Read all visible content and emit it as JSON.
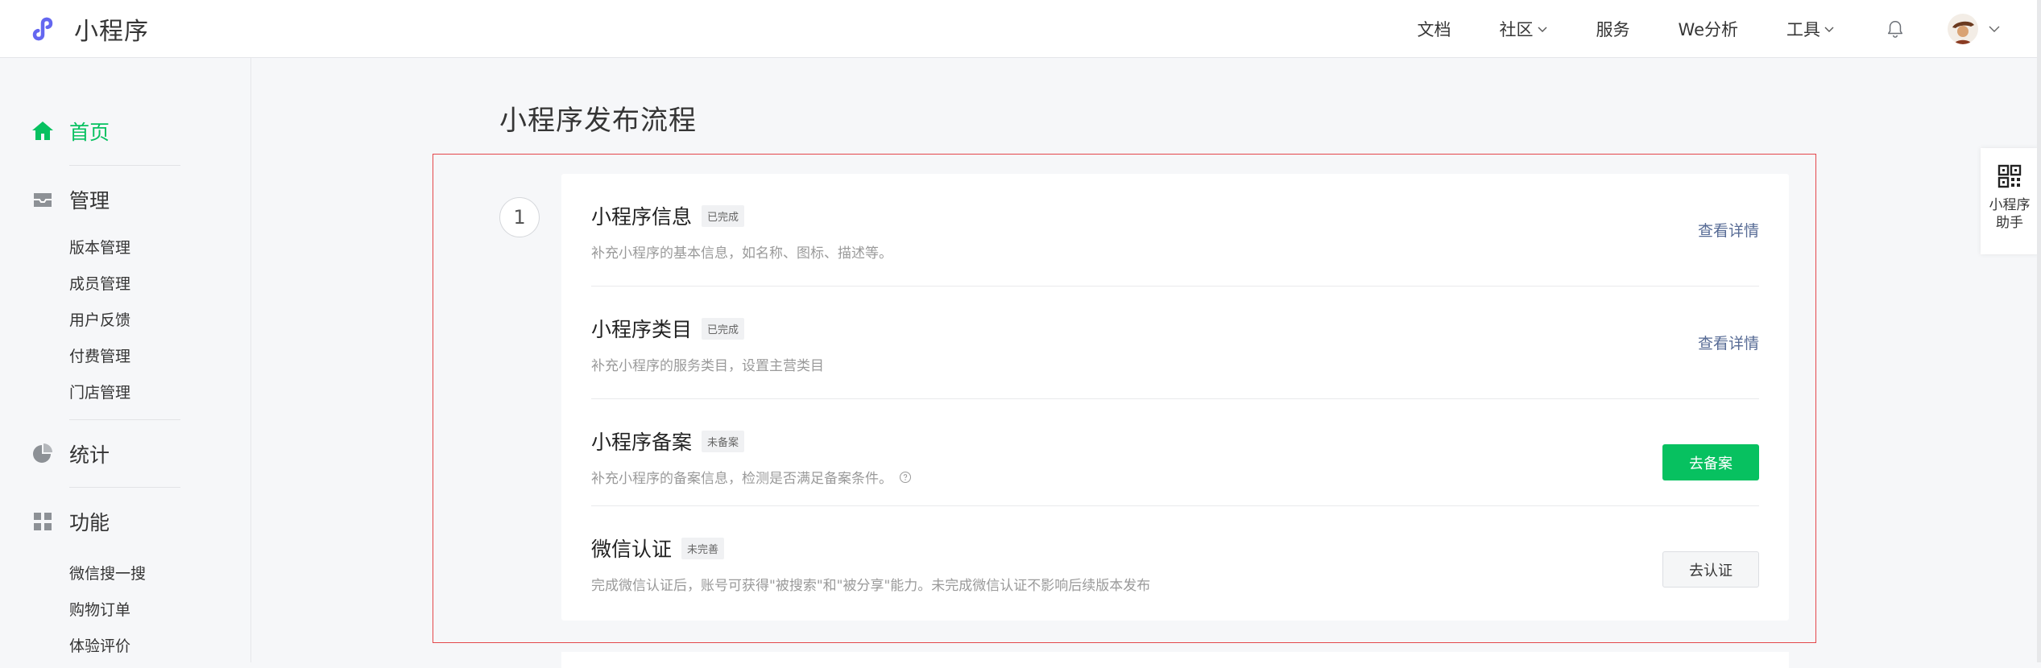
{
  "brand": {
    "name": "小程序",
    "accent": "#6467f0"
  },
  "topnav": {
    "items": [
      {
        "label": "文档",
        "dropdown": false
      },
      {
        "label": "社区",
        "dropdown": true
      },
      {
        "label": "服务",
        "dropdown": false
      },
      {
        "label": "We分析",
        "dropdown": false
      },
      {
        "label": "工具",
        "dropdown": true
      }
    ],
    "bell_icon": "bell-icon",
    "avatar_icon": "avatar"
  },
  "sidebar": {
    "home": {
      "label": "首页",
      "icon": "home-icon"
    },
    "manage": {
      "label": "管理",
      "icon": "inbox-icon",
      "items": [
        "版本管理",
        "成员管理",
        "用户反馈",
        "付费管理",
        "门店管理"
      ]
    },
    "stats": {
      "label": "统计",
      "icon": "pie-chart-icon"
    },
    "features": {
      "label": "功能",
      "icon": "grid-icon",
      "items": [
        "微信搜一搜",
        "购物订单",
        "体验评价"
      ]
    }
  },
  "main": {
    "title": "小程序发布流程",
    "step_number": "1",
    "rows": [
      {
        "title": "小程序信息",
        "badge": "已完成",
        "desc": "补充小程序的基本信息，如名称、图标、描述等。",
        "action": "查看详情",
        "action_type": "link"
      },
      {
        "title": "小程序类目",
        "badge": "已完成",
        "desc": "补充小程序的服务类目，设置主营类目",
        "action": "查看详情",
        "action_type": "link"
      },
      {
        "title": "小程序备案",
        "badge": "未备案",
        "desc": "补充小程序的备案信息，检测是否满足备案条件。",
        "action": "去备案",
        "action_type": "primary"
      },
      {
        "title": "微信认证",
        "badge": "未完善",
        "desc": "完成微信认证后，账号可获得\"被搜索\"和\"被分享\"能力。未完成微信认证不影响后续版本发布",
        "action": "去认证",
        "action_type": "default"
      }
    ]
  },
  "helper": {
    "label": "小程序助手",
    "icon": "qr-code-icon"
  },
  "colors": {
    "green": "#07c160",
    "link": "#576b95",
    "highlight_border": "#e4474b"
  }
}
